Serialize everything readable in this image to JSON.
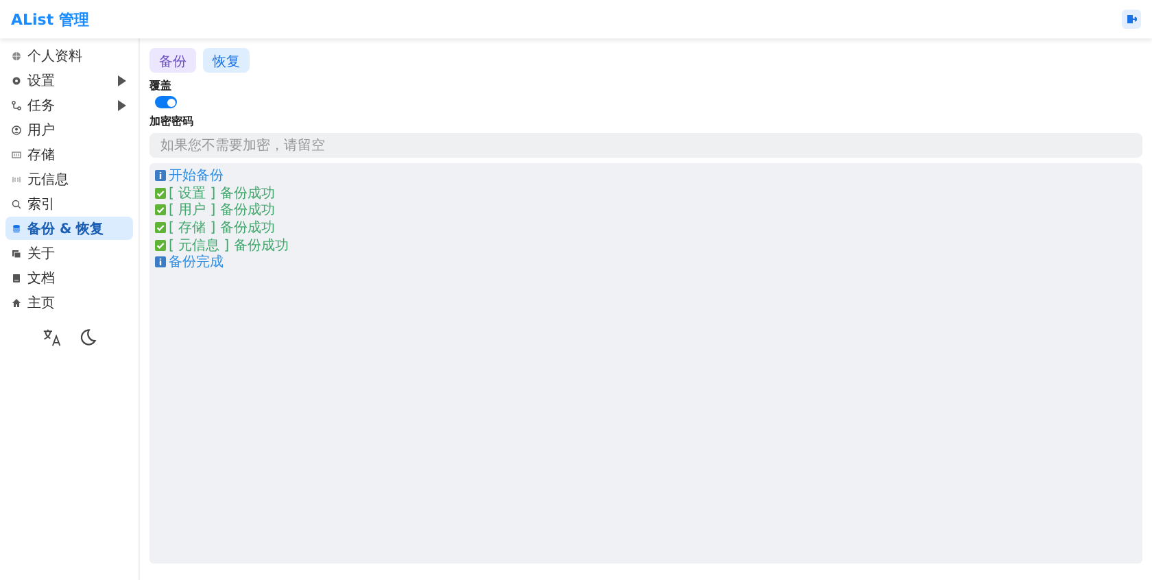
{
  "header": {
    "title": "AList 管理"
  },
  "sidebar": {
    "items": [
      {
        "label": "个人资料",
        "selected": false,
        "expandable": false
      },
      {
        "label": "设置",
        "selected": false,
        "expandable": true
      },
      {
        "label": "任务",
        "selected": false,
        "expandable": true
      },
      {
        "label": "用户",
        "selected": false,
        "expandable": false
      },
      {
        "label": "存储",
        "selected": false,
        "expandable": false
      },
      {
        "label": "元信息",
        "selected": false,
        "expandable": false
      },
      {
        "label": "索引",
        "selected": false,
        "expandable": false
      },
      {
        "label": "备份 & 恢复",
        "selected": true,
        "expandable": false
      },
      {
        "label": "关于",
        "selected": false,
        "expandable": false
      },
      {
        "label": "文档",
        "selected": false,
        "expandable": false
      },
      {
        "label": "主页",
        "selected": false,
        "expandable": false
      }
    ]
  },
  "buttons": [
    {
      "label": "备份",
      "kind": "backup"
    },
    {
      "label": "恢复",
      "kind": "restore"
    }
  ],
  "override": {
    "label": "覆盖",
    "on": true
  },
  "password": {
    "label": "加密密码",
    "placeholder": "如果您不需要加密，请留空"
  },
  "log": [
    {
      "kind": "info",
      "text": "开始备份"
    },
    {
      "kind": "success",
      "text": "[ 设置 ] 备份成功"
    },
    {
      "kind": "success",
      "text": "[ 用户 ] 备份成功"
    },
    {
      "kind": "success",
      "text": "[ 存储 ] 备份成功"
    },
    {
      "kind": "success",
      "text": "[ 元信息 ] 备份成功"
    },
    {
      "kind": "info",
      "text": "备份完成"
    }
  ]
}
